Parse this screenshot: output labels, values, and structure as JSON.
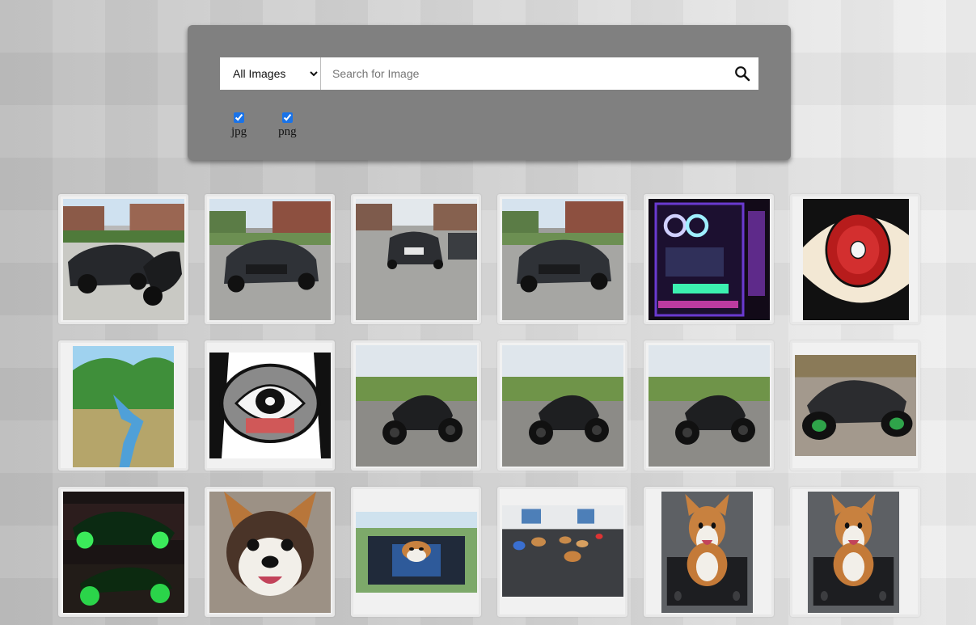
{
  "search": {
    "type_options": [
      "All Images"
    ],
    "type_selected": "All Images",
    "placeholder": "Search for Image",
    "value": ""
  },
  "filters": [
    {
      "label": "jpg",
      "checked": true
    },
    {
      "label": "png",
      "checked": true
    }
  ],
  "gallery": {
    "images": [
      {
        "subject": "dark sedan and motorcycle in driveway",
        "kind": "photo-car-moto"
      },
      {
        "subject": "dark sedan front view",
        "kind": "photo-car"
      },
      {
        "subject": "dark sedan rear view",
        "kind": "photo-car-rear"
      },
      {
        "subject": "dark sedan three-quarter view",
        "kind": "photo-car"
      },
      {
        "subject": "gaming PC with RGB lights",
        "kind": "photo-pc"
      },
      {
        "subject": "drawing of a red eye",
        "kind": "drawing-eye"
      },
      {
        "subject": "painting of river valley",
        "kind": "drawing-river"
      },
      {
        "subject": "drawing of eye in mouth",
        "kind": "drawing-mouth"
      },
      {
        "subject": "black motorcycle in field",
        "kind": "photo-moto"
      },
      {
        "subject": "black motorcycle in field",
        "kind": "photo-moto"
      },
      {
        "subject": "black motorcycle close up",
        "kind": "photo-moto"
      },
      {
        "subject": "black motorcycle on gravel",
        "kind": "photo-moto-gravel"
      },
      {
        "subject": "motorcycles with green lights",
        "kind": "photo-green-night"
      },
      {
        "subject": "corgi face close up",
        "kind": "photo-corgi-face"
      },
      {
        "subject": "corgi on camping chair",
        "kind": "photo-corgi-chair"
      },
      {
        "subject": "corgis at training gym",
        "kind": "photo-corgi-gym"
      },
      {
        "subject": "corgi sitting on crate",
        "kind": "photo-corgi-crate"
      },
      {
        "subject": "corgi sitting on crate",
        "kind": "photo-corgi-crate"
      }
    ]
  },
  "icons": {
    "search": "search-icon"
  },
  "colors": {
    "panel": "#808080",
    "accent": "#1a73e8"
  }
}
